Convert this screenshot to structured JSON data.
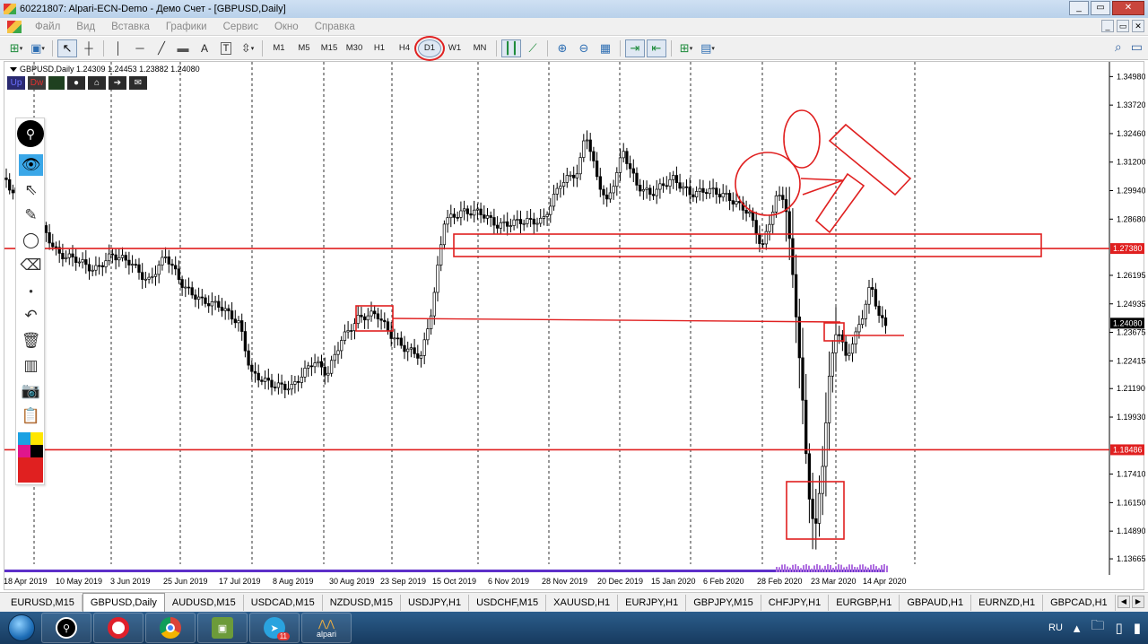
{
  "window": {
    "title": "60221807: Alpari-ECN-Demo - Демо Счет - [GBPUSD,Daily]",
    "buttons": [
      "_",
      "▭",
      "✕"
    ]
  },
  "menu": {
    "items": [
      "Файл",
      "Вид",
      "Вставка",
      "Графики",
      "Сервис",
      "Окно",
      "Справка"
    ]
  },
  "toolbar": {
    "timeframes": [
      "M1",
      "M5",
      "M15",
      "M30",
      "H1",
      "H4",
      "D1",
      "W1",
      "MN"
    ],
    "active_timeframe": "D1",
    "annotation_color": "#e02020"
  },
  "chart": {
    "info": "GBPUSD,Daily  1.24309 1.24453 1.23882 1.24080",
    "indicator_buttons": [
      "Up",
      "Dw"
    ],
    "current_price_label": "1.24080",
    "level_labels": [
      "1.27380",
      "1.18486"
    ],
    "price_ticks": [
      "1.34980",
      "1.33720",
      "1.32460",
      "1.31200",
      "1.29940",
      "1.28680",
      "1.27380",
      "1.26195",
      "1.24935",
      "1.24080",
      "1.23675",
      "1.22415",
      "1.21190",
      "1.19930",
      "1.18486",
      "1.17410",
      "1.16150",
      "1.14890",
      "1.13665"
    ],
    "time_ticks": [
      "18 Apr 2019",
      "10 May 2019",
      "3 Jun 2019",
      "25 Jun 2019",
      "17 Jul 2019",
      "8 Aug 2019",
      "30 Aug 2019",
      "23 Sep 2019",
      "15 Oct 2019",
      "6 Nov 2019",
      "28 Nov 2019",
      "20 Dec 2019",
      "15 Jan 2020",
      "6 Feb 2020",
      "28 Feb 2020",
      "23 Mar 2020",
      "14 Apr 2020"
    ],
    "colors": {
      "candle": "#000000",
      "level_line": "#e02020",
      "price_label_bg": "#e02020",
      "current_price_bg": "#000000",
      "volume": "#5d2fc9"
    }
  },
  "draw_panel": {
    "tools": [
      "logo-icon",
      "eye-icon",
      "cursor-icon",
      "pencil-icon",
      "circle-icon",
      "eraser-icon",
      "dot-icon",
      "undo-icon",
      "trash-icon",
      "template-icon",
      "camera-icon",
      "clipboard-icon"
    ],
    "swatches": [
      "#1ba1e2",
      "#ffe600",
      "#e0168c",
      "#000000",
      "#e02020"
    ]
  },
  "tabs": {
    "items": [
      "EURUSD,M15",
      "GBPUSD,Daily",
      "AUDUSD,M15",
      "USDCAD,M15",
      "NZDUSD,M15",
      "USDJPY,H1",
      "USDCHF,M15",
      "XAUUSD,H1",
      "EURJPY,H1",
      "GBPJPY,M15",
      "CHFJPY,H1",
      "EURGBP,H1",
      "GBPAUD,H1",
      "EURNZD,H1",
      "GBPCAD,H1"
    ],
    "active": "GBPUSD,Daily"
  },
  "taskbar": {
    "apps": [
      "metatrader-icon",
      "opera-icon",
      "chrome-icon",
      "remote-icon",
      "telegram-icon",
      "alpari-icon"
    ],
    "telegram_badge": "11",
    "alpari_label": "alpari",
    "language": "RU"
  }
}
